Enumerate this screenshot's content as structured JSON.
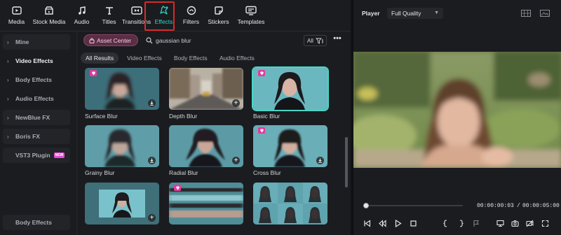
{
  "toolbar": {
    "items": [
      {
        "label": "Media",
        "icon": "media-icon"
      },
      {
        "label": "Stock Media",
        "icon": "stock-media-icon"
      },
      {
        "label": "Audio",
        "icon": "audio-icon"
      },
      {
        "label": "Titles",
        "icon": "titles-icon"
      },
      {
        "label": "Transitions",
        "icon": "transitions-icon"
      },
      {
        "label": "Effects",
        "icon": "effects-icon",
        "active": true
      },
      {
        "label": "Filters",
        "icon": "filters-icon"
      },
      {
        "label": "Stickers",
        "icon": "stickers-icon"
      },
      {
        "label": "Templates",
        "icon": "templates-icon"
      }
    ],
    "accent_color": "#2fd5c1",
    "highlight_color": "#d92a2a"
  },
  "sidebar": {
    "items": [
      {
        "label": "Mine"
      },
      {
        "label": "Video Effects"
      },
      {
        "label": "Body Effects"
      },
      {
        "label": "Audio Effects"
      },
      {
        "label": "NewBlue FX"
      },
      {
        "label": "Boris FX"
      },
      {
        "label": "VST3 Plugin",
        "badge": "NEW"
      }
    ],
    "bottom_label": "Body Effects"
  },
  "search": {
    "asset_center_label": "Asset Center",
    "query": "gaussian blur",
    "filter_label": "All",
    "more_label": "•••"
  },
  "tabs": [
    "All Results",
    "Video Effects",
    "Body Effects",
    "Audio Effects"
  ],
  "results": [
    {
      "name": "Surface Blur",
      "premium": true,
      "action": "download"
    },
    {
      "name": "Depth Blur",
      "premium": false,
      "action": "add"
    },
    {
      "name": "Basic Blur",
      "premium": true,
      "action": "none",
      "selected": true
    },
    {
      "name": "Grainy Blur",
      "premium": false,
      "action": "download"
    },
    {
      "name": "Radial Blur",
      "premium": false,
      "action": "add"
    },
    {
      "name": "Cross Blur",
      "premium": true,
      "action": "download"
    },
    {
      "name": "",
      "premium": false,
      "action": "add"
    },
    {
      "name": "",
      "premium": true,
      "action": "none"
    },
    {
      "name": "",
      "premium": false,
      "action": "none"
    }
  ],
  "player": {
    "title": "Player",
    "quality": "Full Quality",
    "current_time": "00:00:00:03",
    "separator": "/",
    "total_time": "00:00:05:00",
    "progress": 0.01
  }
}
